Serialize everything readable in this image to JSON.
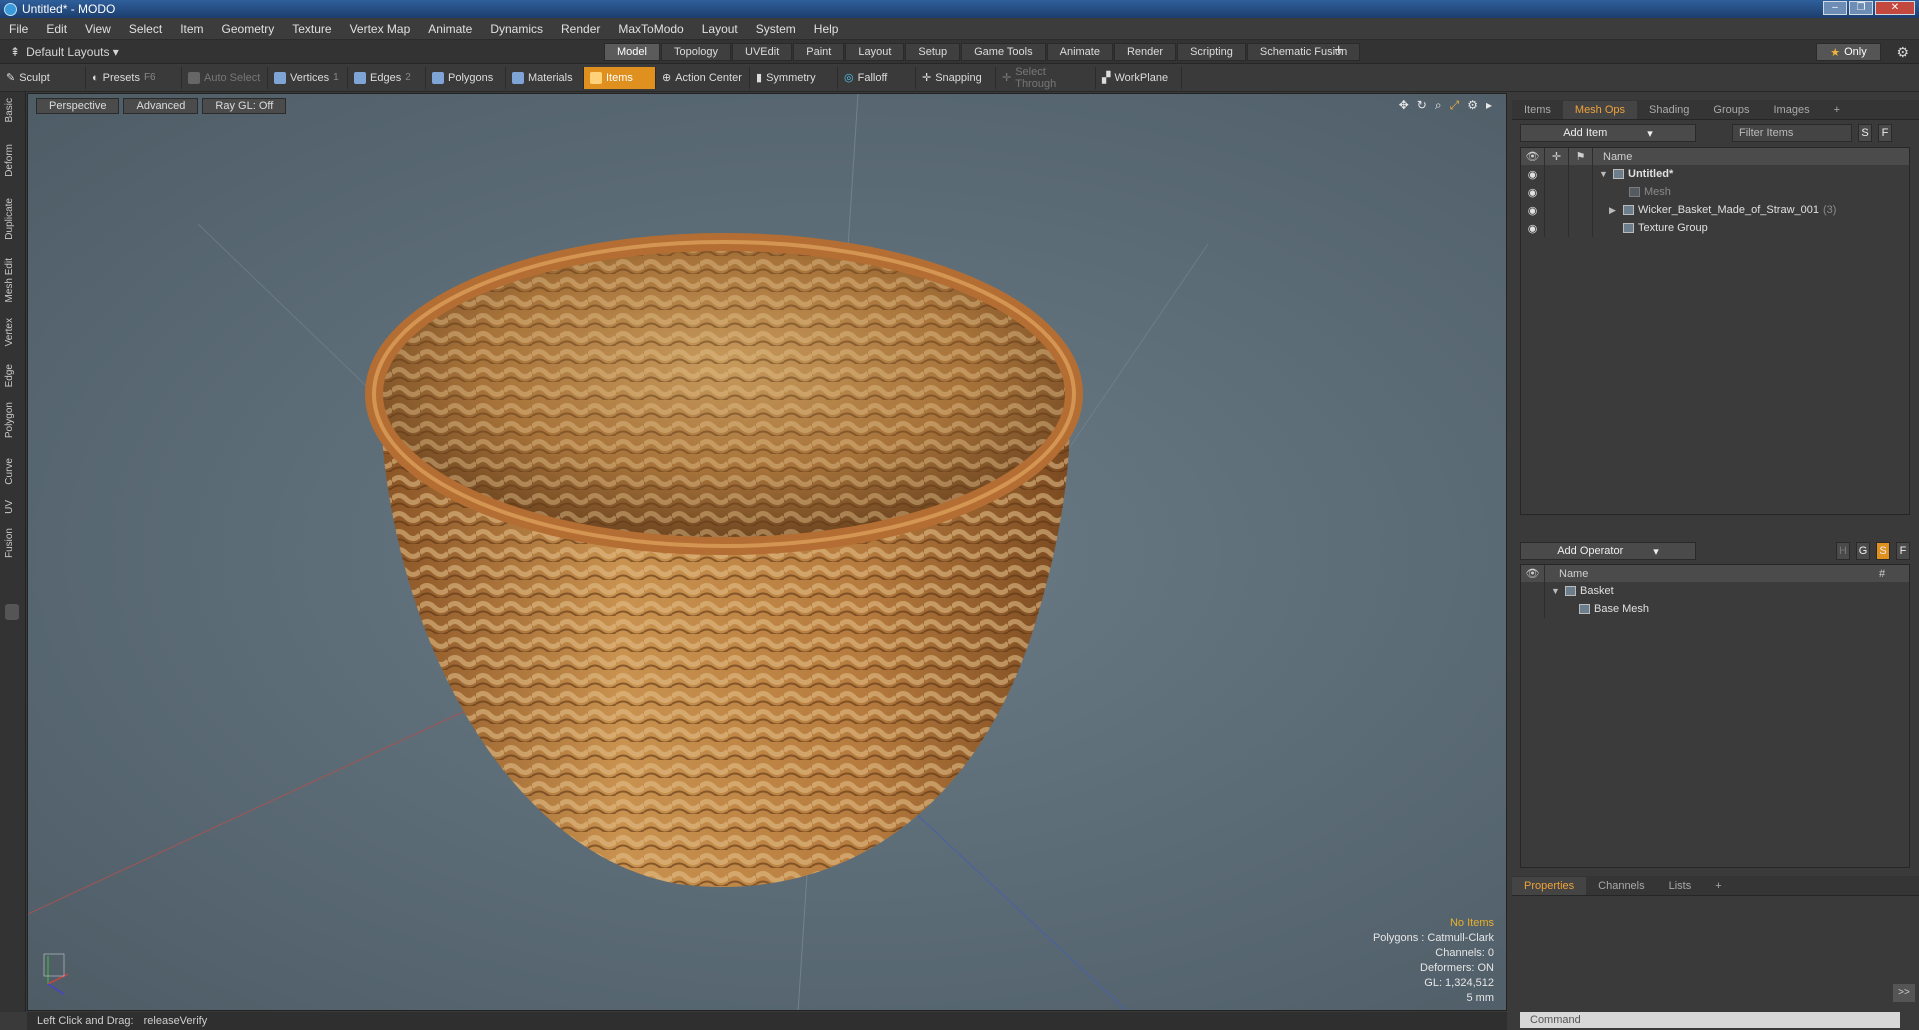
{
  "window": {
    "title": "Untitled* - MODO"
  },
  "menu": [
    "File",
    "Edit",
    "View",
    "Select",
    "Item",
    "Geometry",
    "Texture",
    "Vertex Map",
    "Animate",
    "Dynamics",
    "Render",
    "MaxToModo",
    "Layout",
    "System",
    "Help"
  ],
  "layouts": {
    "selector": "Default Layouts ▾"
  },
  "tabs": [
    {
      "label": "Model",
      "active": true
    },
    {
      "label": "Topology"
    },
    {
      "label": "UVEdit"
    },
    {
      "label": "Paint"
    },
    {
      "label": "Layout"
    },
    {
      "label": "Setup"
    },
    {
      "label": "Game Tools"
    },
    {
      "label": "Animate"
    },
    {
      "label": "Render"
    },
    {
      "label": "Scripting"
    },
    {
      "label": "Schematic Fusion"
    }
  ],
  "only_label": "Only",
  "toolbar": [
    {
      "label": "Sculpt"
    },
    {
      "label": "Presets",
      "key": "F6"
    },
    {
      "label": "Auto Select",
      "dim": true
    },
    {
      "label": "Vertices",
      "key": "1"
    },
    {
      "label": "Edges",
      "key": "2"
    },
    {
      "label": "Polygons"
    },
    {
      "label": "Materials"
    },
    {
      "label": "Items",
      "selected": true
    },
    {
      "label": "Action Center"
    },
    {
      "label": "Symmetry"
    },
    {
      "label": "Falloff"
    },
    {
      "label": "Snapping"
    },
    {
      "label": "Select Through",
      "dim": true
    },
    {
      "label": "WorkPlane"
    }
  ],
  "left_tabs": [
    "Basic",
    "Deform",
    "Duplicate",
    "Mesh Edit",
    "Vertex",
    "Edge",
    "Polygon",
    "Curve",
    "UV",
    "Fusion"
  ],
  "viewport": {
    "buttons": [
      "Perspective",
      "Advanced",
      "Ray GL: Off"
    ],
    "info": {
      "items": "No Items",
      "polygons": "Polygons : Catmull-Clark",
      "channels": "Channels: 0",
      "deformers": "Deformers: ON",
      "gl": "GL: 1,324,512",
      "scale": "5 mm"
    }
  },
  "status": {
    "label": "Left Click and Drag:",
    "value": "releaseVerify"
  },
  "items_panel": {
    "tabs": [
      {
        "label": "Items"
      },
      {
        "label": "Mesh Ops",
        "active": true
      },
      {
        "label": "Shading"
      },
      {
        "label": "Groups"
      },
      {
        "label": "Images"
      }
    ],
    "add_item": "Add Item",
    "filter": "Filter Items",
    "sf": [
      "S",
      "F"
    ],
    "name_col": "Name",
    "rows": [
      {
        "label": "Untitled*",
        "bold": true,
        "indent": 0,
        "expand": "▼"
      },
      {
        "label": "Mesh",
        "dim": true,
        "indent": 1
      },
      {
        "label": "Wicker_Basket_Made_of_Straw_001",
        "count": "(3)",
        "indent": 1,
        "expand": "▶"
      },
      {
        "label": "Texture Group",
        "indent": 1
      }
    ]
  },
  "ops_panel": {
    "add_operator": "Add Operator",
    "flags": [
      "H",
      "G",
      "S",
      "F"
    ],
    "name_col": "Name",
    "hash_col": "#",
    "rows": [
      {
        "label": "Basket",
        "indent": 0,
        "expand": "▼"
      },
      {
        "label": "Base Mesh",
        "indent": 1
      }
    ]
  },
  "bottom_tabs": [
    {
      "label": "Properties",
      "active": true
    },
    {
      "label": "Channels"
    },
    {
      "label": "Lists"
    }
  ],
  "command": {
    "placeholder": "Command"
  }
}
